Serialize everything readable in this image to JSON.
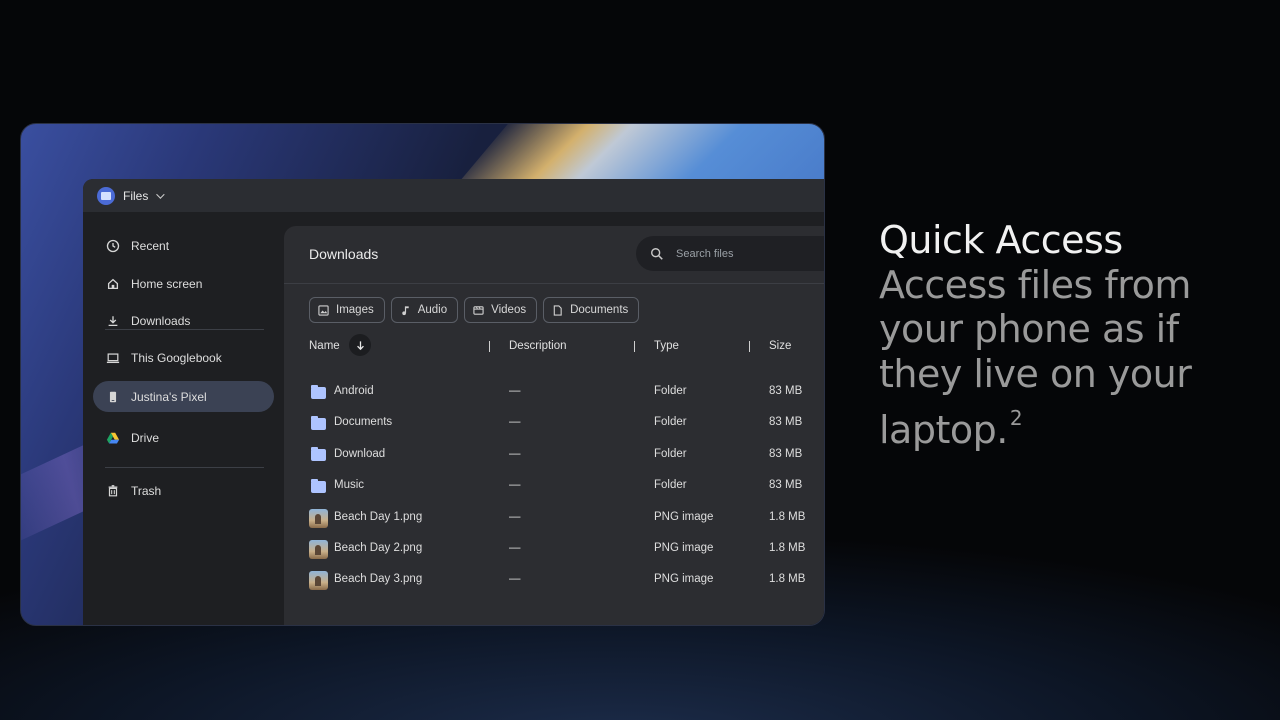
{
  "app": {
    "name": "Files"
  },
  "sidebar": {
    "items": [
      {
        "label": "Recent",
        "icon": "clock-icon"
      },
      {
        "label": "Home screen",
        "icon": "home-icon"
      },
      {
        "label": "Downloads",
        "icon": "download-icon"
      },
      {
        "label": "This Googlebook",
        "icon": "laptop-icon"
      },
      {
        "label": "Justina's Pixel",
        "icon": "phone-icon",
        "active": true
      },
      {
        "label": "Drive",
        "icon": "drive-icon"
      },
      {
        "label": "Trash",
        "icon": "trash-icon"
      }
    ]
  },
  "main": {
    "title": "Downloads",
    "search_placeholder": "Search files",
    "filters": [
      {
        "label": "Images",
        "icon": "image-icon"
      },
      {
        "label": "Audio",
        "icon": "music-note-icon"
      },
      {
        "label": "Videos",
        "icon": "film-icon"
      },
      {
        "label": "Documents",
        "icon": "document-icon"
      }
    ],
    "columns": {
      "name": "Name",
      "description": "Description",
      "type": "Type",
      "size": "Size"
    },
    "sort_direction": "descending",
    "rows": [
      {
        "name": "Android",
        "description": "—",
        "type": "Folder",
        "size": "83 MB",
        "kind": "folder"
      },
      {
        "name": "Documents",
        "description": "—",
        "type": "Folder",
        "size": "83 MB",
        "kind": "folder"
      },
      {
        "name": "Download",
        "description": "—",
        "type": "Folder",
        "size": "83 MB",
        "kind": "folder"
      },
      {
        "name": "Music",
        "description": "—",
        "type": "Folder",
        "size": "83 MB",
        "kind": "folder"
      },
      {
        "name": "Beach Day 1.png",
        "description": "—",
        "type": "PNG image",
        "size": "1.8 MB",
        "kind": "image"
      },
      {
        "name": "Beach Day 2.png",
        "description": "—",
        "type": "PNG image",
        "size": "1.8 MB",
        "kind": "image"
      },
      {
        "name": "Beach Day 3.png",
        "description": "—",
        "type": "PNG image",
        "size": "1.8 MB",
        "kind": "image"
      }
    ]
  },
  "hero": {
    "title": "Quick Access",
    "body": "Access files from your phone as if they live on your laptop.",
    "footnote": "2"
  },
  "colors": {
    "background": "#000000",
    "window_bg": "#1e1f22",
    "panel_bg": "#2c2d31",
    "active_item": "#3b4254",
    "folder_icon": "#aec4ff",
    "hero_title": "#f1f1f1",
    "hero_body": "#9a9a9a"
  }
}
